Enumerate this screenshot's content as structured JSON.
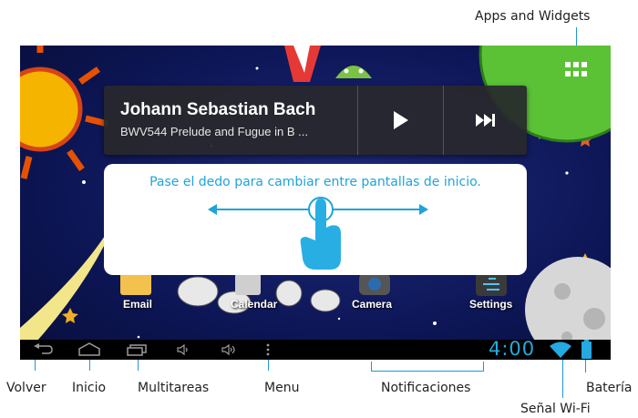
{
  "annotations": {
    "apps_widgets": "Apps and Widgets",
    "volver": "Volver",
    "inicio": "Inicio",
    "multitareas": "Multitareas",
    "menu": "Menu",
    "notificaciones": "Notificaciones",
    "bateria": "Batería",
    "senal_wifi": "Señal Wi-Fi"
  },
  "music_widget": {
    "title": "Johann Sebastian Bach",
    "subtitle": "BWV544 Prelude and Fugue in B ...",
    "play_icon": "play-icon",
    "next_icon": "skip-next-icon"
  },
  "hint": {
    "message": "Pase el dedo para cambiar entre pantallas de inicio."
  },
  "apps": [
    {
      "label": "Email"
    },
    {
      "label": "Calendar"
    },
    {
      "label": "Camera"
    },
    {
      "label": "Settings"
    }
  ],
  "status": {
    "time": "4:00"
  },
  "colors": {
    "accent": "#26a8e0",
    "annotation_line": "#2196d8",
    "widget_bg": "#28282c"
  }
}
